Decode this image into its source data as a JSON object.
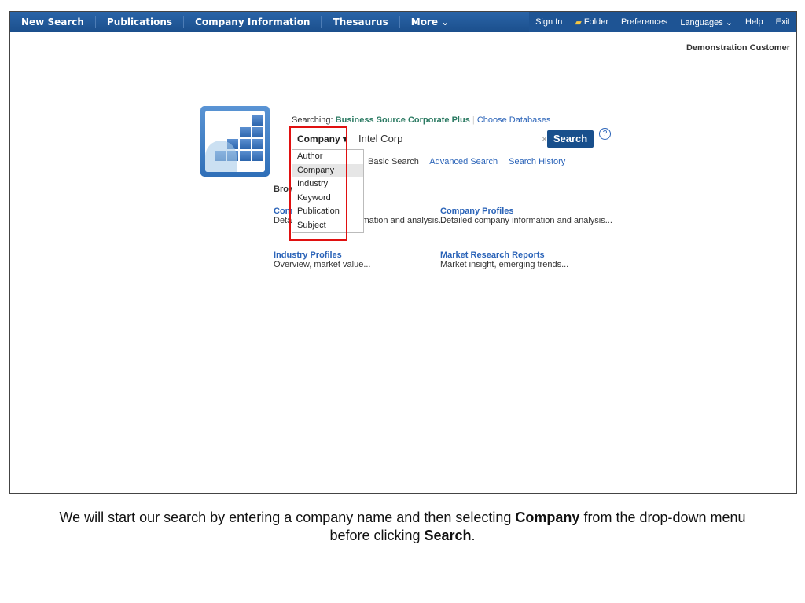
{
  "nav": {
    "left": [
      "New Search",
      "Publications",
      "Company Information",
      "Thesaurus",
      "More ⌄"
    ],
    "right": [
      "Sign In",
      "Folder",
      "Preferences",
      "Languages ⌄",
      "Help",
      "Exit"
    ]
  },
  "user": "Demonstration Customer",
  "search": {
    "searching_label": "Searching:",
    "database": "Business Source Corporate Plus",
    "choose": "Choose Databases",
    "field": "Company ▾",
    "value": "Intel Corp",
    "clear": "×",
    "button": "Search",
    "help": "?"
  },
  "links": [
    "Basic Search",
    "Advanced Search",
    "Search History"
  ],
  "dropdown": [
    "Author",
    "Company",
    "Industry",
    "Keyword",
    "Publication",
    "Subject"
  ],
  "browse": {
    "title": "Browse",
    "items": [
      {
        "title": "Company Information",
        "desc": "Detailed company information and analysis..."
      },
      {
        "title": "Company Profiles",
        "desc": "Detailed company information and analysis..."
      },
      {
        "title": "Industry Profiles",
        "desc": "Overview, market value..."
      },
      {
        "title": "Market Research Reports",
        "desc": "Market insight, emerging trends..."
      }
    ]
  },
  "caption": {
    "p1": "We will start our search by entering a company name and then selecting ",
    "b1": "Company",
    "p2": " from the drop-down menu before clicking ",
    "b2": "Search",
    "p3": "."
  }
}
